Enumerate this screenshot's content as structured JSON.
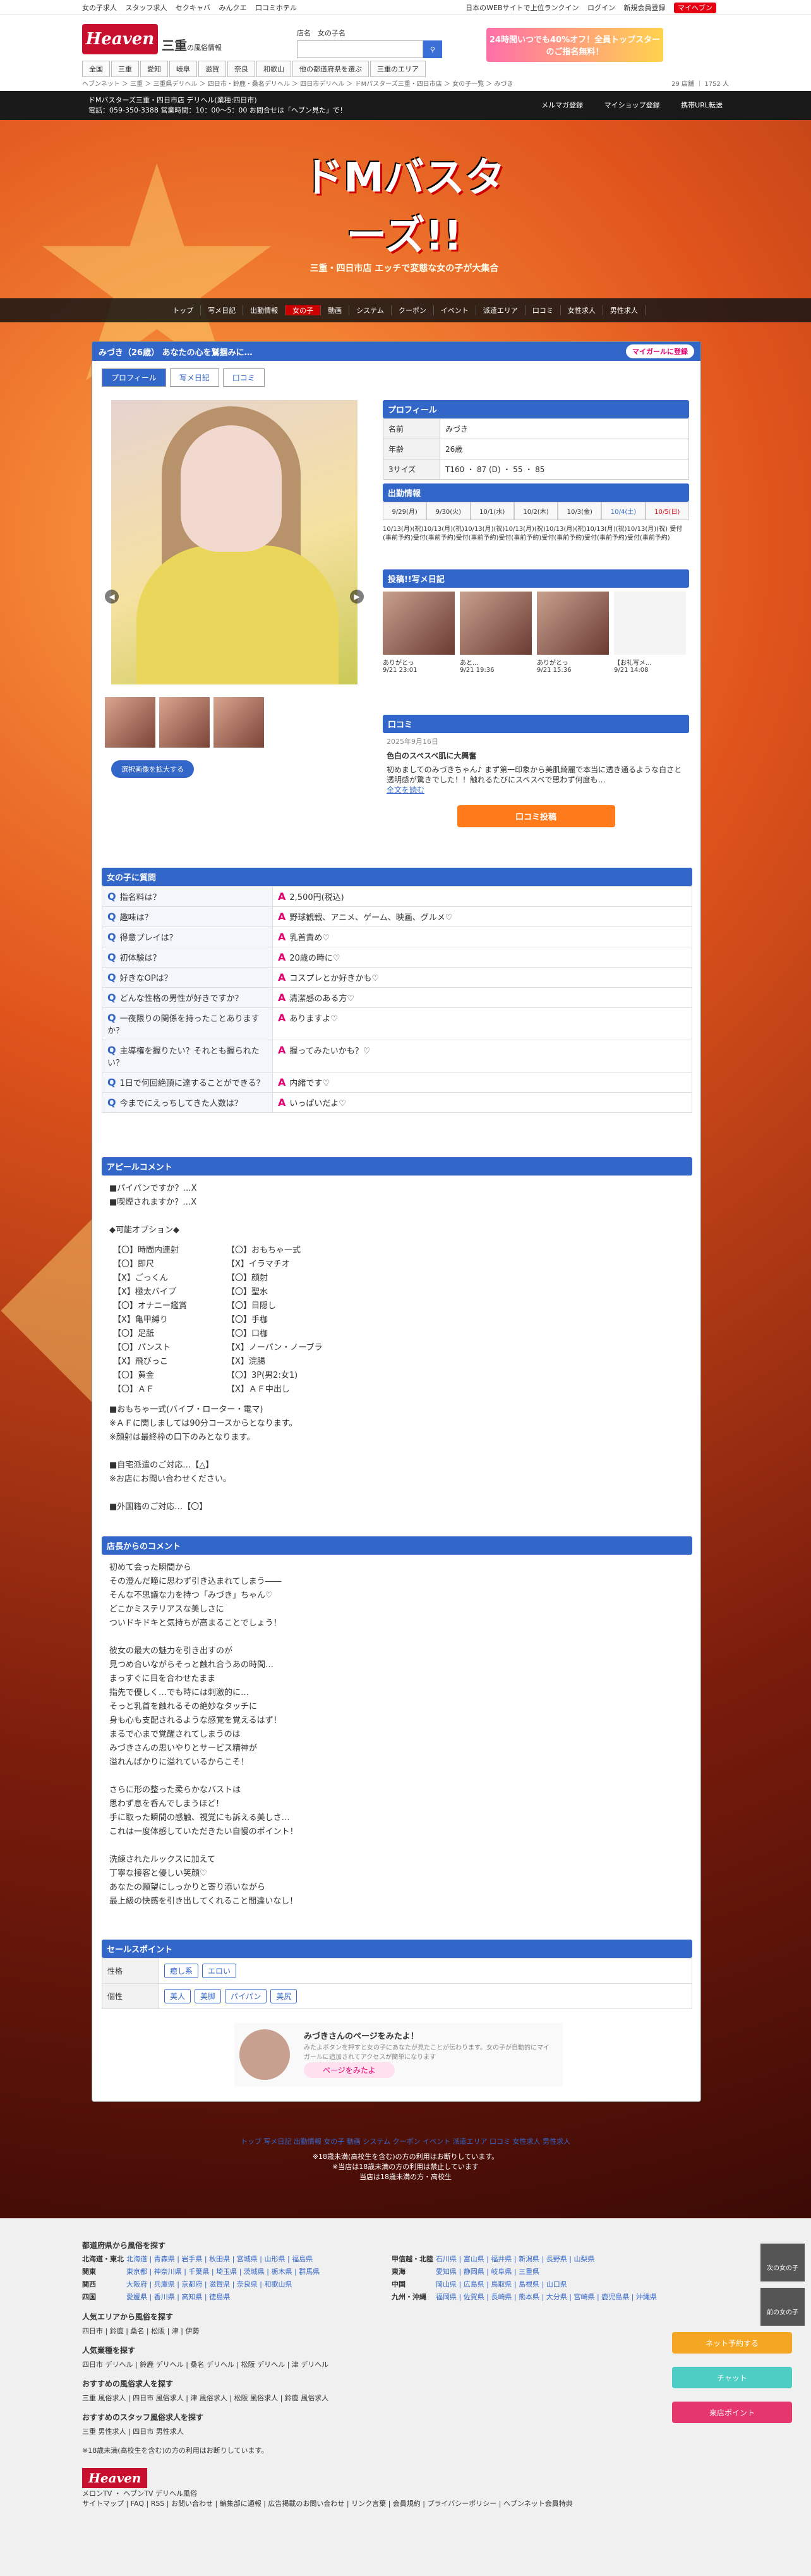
{
  "topbar": {
    "links": [
      "女の子求人",
      "スタッフ求人",
      "セクキャバ",
      "みんクエ",
      "口コミホテル"
    ],
    "right": [
      "日本のWEBサイトで上位ランクイン",
      "ログイン",
      "新規会員登録"
    ],
    "heaven": "マイヘブン"
  },
  "header": {
    "logo": "Heaven",
    "area": "三重",
    "area_sub": "の風俗情報",
    "search_label": "店名",
    "search_label2": "女の子名",
    "banner": "24時間いつでも40%オフ！全員トップスターのご指名無料！",
    "nav": [
      "全国",
      "三重",
      "愛知",
      "岐阜",
      "滋賀",
      "奈良",
      "和歌山",
      "他の都道府県を選ぶ",
      "三重のエリア"
    ]
  },
  "bread": {
    "path": "ヘブンネット ＞ 三重 ＞ 三重県デリヘル ＞ 四日市・鈴鹿・桑名デリヘル ＞ 四日市デリヘル ＞ ドMバスターズ三重・四日市店 ＞ 女の子一覧 ＞ みづき",
    "count": "29 店舗 ｜ 1752 人"
  },
  "shop": {
    "line1": "ドMバスターズ三重・四日市店 デリヘル(業種:四日市)",
    "line2": "電話：059-350-3388 営業時間：10：00～5：00 お問合せは「ヘブン見た」で！",
    "right": [
      "メルマガ登録",
      "マイショップ登録",
      "携帯URL転送"
    ],
    "logo": "ドMバスターズ!!",
    "logo_sub": "三重・四日市店 エッチで変態な女の子が大集合"
  },
  "menu": [
    "トップ",
    "写メ日記",
    "出勤情報",
    "女の子",
    "動画",
    "システム",
    "クーポン",
    "イベント",
    "派遣エリア",
    "口コミ",
    "女性求人",
    "男性求人"
  ],
  "girl": {
    "title": "みづき（26歳） あなたの心を鷲掴みに…",
    "mygirl": "マイガールに登録",
    "tabs": [
      "プロフィール",
      "写メ日記",
      "口コミ"
    ],
    "select_btn": "選択画像を拡大する"
  },
  "profile": {
    "heading": "プロフィール",
    "rows": [
      {
        "k": "名前",
        "v": "みづき"
      },
      {
        "k": "年齢",
        "v": "26歳"
      },
      {
        "k": "3サイズ",
        "v": "T160 ・ 87 (D) ・ 55 ・ 85"
      }
    ]
  },
  "schedule": {
    "heading": "出勤情報",
    "days": [
      "9/29(月)",
      "9/30(火)",
      "10/1(水)",
      "10/2(木)",
      "10/3(金)",
      "10/4(土)",
      "10/5(日)"
    ],
    "note": "10/13(月)(祝)10/13(月)(祝)10/13(月)(祝)10/13(月)(祝)10/13(月)(祝)10/13(月)(祝)10/13(月)(祝) 受付(事前予約)受付(事前予約)受付(事前予約)受付(事前予約)受付(事前予約)受付(事前予約)受付(事前予約)"
  },
  "diary": {
    "heading": "投稿!!写メ日記",
    "items": [
      {
        "t": "ありがとっ",
        "d": "9/21 23:01"
      },
      {
        "t": "あと...",
        "d": "9/21 19:36"
      },
      {
        "t": "ありがとっ",
        "d": "9/21 15:36"
      },
      {
        "t": "【お礼写メ...",
        "d": "9/21 14:08"
      }
    ]
  },
  "review": {
    "heading": "口コミ",
    "date": "2025年9月16日",
    "title": "色白のスペスベ肌に大興奮",
    "body": "初めましてのみづきちゃん♪ まず第一印象から美肌綺麗で本当に透き通るような白さと透明感が驚きでした！！触れるたびにスベスベで思わず何度も…",
    "more": "全文を読む",
    "btn": "口コミ投稿"
  },
  "qa": {
    "heading": "女の子に質問",
    "rows": [
      {
        "q": "指名料は？",
        "a": "2,500円(税込)"
      },
      {
        "q": "趣味は？",
        "a": "野球観戦、アニメ、ゲーム、映画、グルメ♡"
      },
      {
        "q": "得意プレイは？",
        "a": "乳首責め♡"
      },
      {
        "q": "初体験は？",
        "a": "20歳の時に♡"
      },
      {
        "q": "好きなOPは？",
        "a": "コスプレとか好きかも♡"
      },
      {
        "q": "どんな性格の男性が好きですか？",
        "a": "清潔感のある方♡"
      },
      {
        "q": "一夜限りの関係を持ったことありますか？",
        "a": "ありますよ♡"
      },
      {
        "q": "主導権を握りたい？それとも握られたい？",
        "a": "握ってみたいかも？♡"
      },
      {
        "q": "1日で何回絶頂に達することができる？",
        "a": "内緒です♡"
      },
      {
        "q": "今までにえっちしてきた人数は？",
        "a": "いっぱいだよ♡"
      }
    ]
  },
  "appeal": {
    "heading": "アピールコメント",
    "lines1": "■パイパンですか？…X\n■喫煙されますか？…X\n\n◆可能オプション◆",
    "opts_left": [
      "【〇】時間内連射",
      "【〇】即尺",
      "【X】ごっくん",
      "【X】極太バイブ",
      "【〇】オナニー鑑賞",
      "【X】亀甲縛り",
      "【〇】足舐",
      "【〇】パンスト",
      "【X】飛びっこ",
      "【〇】黄金",
      "【〇】ＡＦ"
    ],
    "opts_right": [
      "【〇】おもちゃ一式",
      "【X】イラマチオ",
      "【〇】顔射",
      "【〇】聖水",
      "【〇】目隠し",
      "【〇】手枷",
      "【〇】口枷",
      "【X】ノーパン・ノーブラ",
      "【X】浣腸",
      "【〇】3P(男2:女1)",
      "【X】ＡＦ中出し"
    ],
    "lines2": "■おもちゃ一式(バイブ・ローター・電マ)\n※ＡＦに関しましては90分コースからとなります。\n※顔射は最終枠の口下のみとなります。\n\n■自宅派遣のご対応…【△】\n※お店にお問い合わせください。\n\n■外国籍のご対応…【〇】"
  },
  "shopcomment": {
    "heading": "店長からのコメント",
    "body": "初めて会った瞬間から\nその澄んだ瞳に思わず引き込まれてしまう――\nそんな不思議な力を持つ「みづき」ちゃん♡\nどこかミステリアスな美しさに\nついドキドキと気持ちが高まることでしょう！\n\n彼女の最大の魅力を引き出すのが\n見つめ合いながらそっと触れ合うあの時間…\nまっすぐに目を合わせたまま\n指先で優しく…でも時には刺激的に…\nそっと乳首を触れるその絶妙なタッチに\n身も心も支配されるような感覚を覚えるはず！\nまるで心まで覚醒されてしまうのは\nみづきさんの思いやりとサービス精神が\n溢れんばかりに溢れているからこそ！\n\nさらに形の整った柔らかなバストは\n思わず息を呑んでしまうほど！\n手に取った瞬間の感触、視覚にも訴える美しさ…\nこれは一度体感していただきたい自慢のポイント！\n\n洗練されたルックスに加えて\n丁寧な接客と優しい笑顔♡\nあなたの願望にしっかりと寄り添いながら\n最上級の快感を引き出してくれること間違いなし！"
  },
  "sales": {
    "heading": "セールスポイント",
    "rows": [
      {
        "k": "性格",
        "tags": [
          "癒し系",
          "エロい"
        ]
      },
      {
        "k": "個性",
        "tags": [
          "美人",
          "美脚",
          "パイパン",
          "美尻"
        ]
      }
    ]
  },
  "share": {
    "title": "みづきさんのページをみたよ！",
    "sub": "みたよボタンを押すと女の子にあなたが見たことが伝わります。女の子が自動的にマイガールに追加されてアクセスが簡単になります",
    "btn": "ページをみたよ"
  },
  "botmenu": {
    "line1": "トップ 写メ日記 出勤情報 女の子 動画 システム クーポン イベント 派遣エリア 口コミ 女性求人 男性求人",
    "line2": "※18歳未満(高校生を含む)の方の利用はお断りしています。",
    "line3": "※当店は18歳未満の方の利用は禁止しています",
    "line4": "当店は18歳未満の方・高校生"
  },
  "footer": {
    "h1": "都道府県から風俗を探す",
    "regions": [
      {
        "r": "北海道・東北",
        "p": "北海道 | 青森県 | 岩手県 | 秋田県 | 宮城県 | 山形県 | 福島県"
      },
      {
        "r": "甲信越・北陸",
        "p": "石川県 | 富山県 | 福井県 | 新潟県 | 長野県 | 山梨県"
      },
      {
        "r": "関東",
        "p": "東京都 | 神奈川県 | 千葉県 | 埼玉県 | 茨城県 | 栃木県 | 群馬県"
      },
      {
        "r": "東海",
        "p": "愛知県 | 静岡県 | 岐阜県 | 三重県"
      },
      {
        "r": "関西",
        "p": "大阪府 | 兵庫県 | 京都府 | 滋賀県 | 奈良県 | 和歌山県"
      },
      {
        "r": "中国",
        "p": "岡山県 | 広島県 | 鳥取県 | 島根県 | 山口県"
      },
      {
        "r": "四国",
        "p": "愛媛県 | 香川県 | 高知県 | 徳島県"
      },
      {
        "r": "九州・沖縄",
        "p": "福岡県 | 佐賀県 | 長崎県 | 熊本県 | 大分県 | 宮崎県 | 鹿児島県 | 沖縄県"
      }
    ],
    "h2": "人気エリアから風俗を探す",
    "a2": "四日市 | 鈴鹿 | 桑名 | 松阪 | 津 | 伊勢",
    "h3": "人気業種を探す",
    "a3": "四日市 デリヘル | 鈴鹿 デリヘル | 桑名 デリヘル | 松阪 デリヘル | 津 デリヘル",
    "h4": "おすすめの風俗求人を探す",
    "a4": "三重 風俗求人 | 四日市 風俗求人 | 津 風俗求人 | 松阪 風俗求人 | 鈴鹿 風俗求人",
    "h5": "おすすめのスタッフ風俗求人を探す",
    "a5": "三重 男性求人 | 四日市 男性求人",
    "note": "※18歳未満(高校生を含む)の方の利用はお断りしています。",
    "logo": "Heaven",
    "links": "サイトマップ | FAQ | RSS | お問い合わせ | 編集部に通報 | 広告掲載のお問い合わせ | リンク言葉 | 会員規約 | プライバシーポリシー | ヘブンネット会員特典",
    "sub": "メロンTV ・ ヘブンTV デリヘル風俗"
  },
  "side": {
    "up": "次の女の子",
    "down": "前の女の子",
    "f1": "ネット予約する",
    "f2": "チャット",
    "f3": "来店ポイント"
  }
}
